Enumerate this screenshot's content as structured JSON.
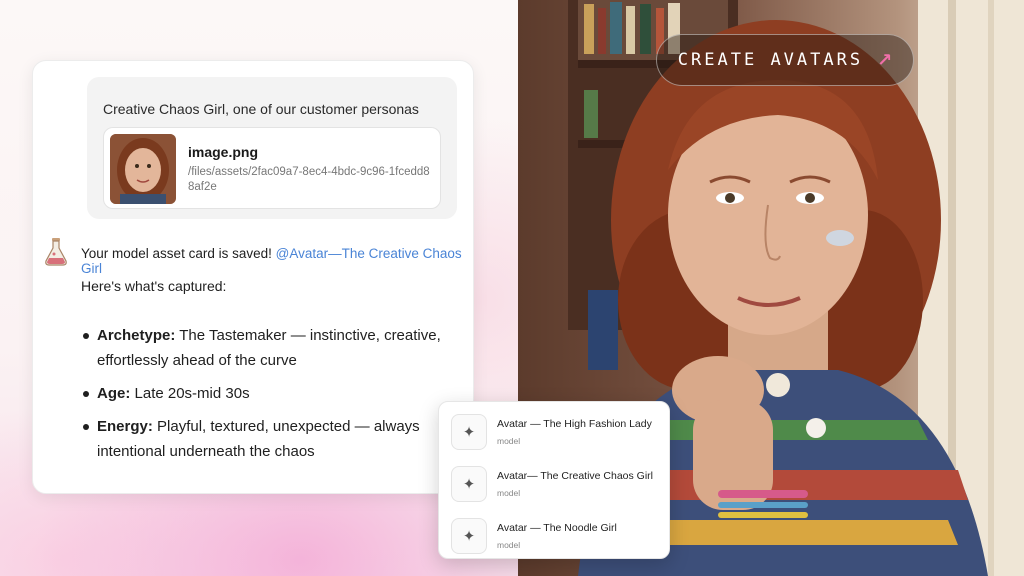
{
  "cta": {
    "label": "CREATE AVATARS",
    "arrow_icon": "arrow-up-right-icon",
    "arrow_color": "#f06fa8"
  },
  "chat": {
    "user_message": "Creative Chaos Girl, one of our customer personas",
    "attachment": {
      "name": "image.png",
      "path": "/files/assets/2fac09a7-8ec4-4bdc-9c96-1fcedd88af2e"
    },
    "bot_icon": "flask-icon",
    "saved_text": "Your model asset card is saved!",
    "mention": "@Avatar—The Creative Chaos Girl",
    "captured_heading": "Here's what's captured:",
    "bullets": [
      {
        "label": "Archetype:",
        "text": "The Tastemaker — instinctive, creative, effortlessly ahead of the curve"
      },
      {
        "label": "Age:",
        "text": "Late 20s-mid 30s"
      },
      {
        "label": "Energy:",
        "text": "Playful, textured, unexpected — always intentional underneath the chaos"
      }
    ]
  },
  "models": [
    {
      "title": "Avatar — The High Fashion Lady",
      "sub": "model",
      "icon": "sparkle-icon"
    },
    {
      "title": "Avatar— The Creative Chaos Girl",
      "sub": "model",
      "icon": "sparkle-icon"
    },
    {
      "title": "Avatar — The Noodle Girl",
      "sub": "model",
      "icon": "sparkle-icon"
    }
  ],
  "colors": {
    "mention": "#4a84d6",
    "accent_pink": "#f06fa8"
  }
}
